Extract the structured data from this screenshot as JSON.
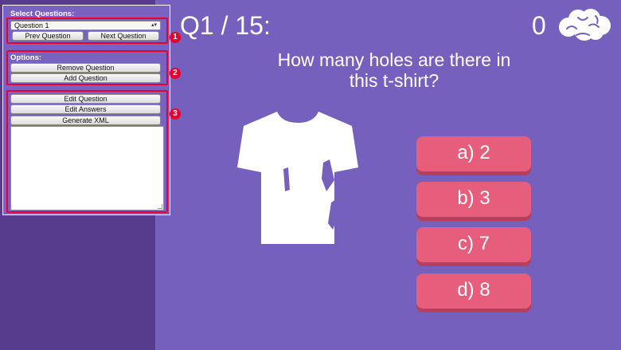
{
  "editor": {
    "select_questions_label": "Select Questions:",
    "selected_question": "Question 1",
    "prev_button": "Prev Question",
    "next_button": "Next Question",
    "options_label": "Options:",
    "remove_button": "Remove Question",
    "add_button": "Add Question",
    "edit_question_button": "Edit Question",
    "edit_answers_button": "Edit Answers",
    "generate_xml_button": "Generate XML",
    "badges": [
      "1",
      "2",
      "3"
    ]
  },
  "quiz": {
    "counter": "Q1 / 15:",
    "score": "0",
    "question": "How many holes are there in this t-shirt?",
    "answers": [
      "a) 2",
      "b) 3",
      "c) 7",
      "d) 8"
    ]
  },
  "colors": {
    "background": "#7660bd",
    "sidebar": "#573b8c",
    "answer_button": "#e65e7c",
    "highlight": "#e8002b"
  },
  "icons": [
    "brain-icon",
    "tshirt-icon",
    "select-arrows-icon",
    "resize-grip-icon"
  ]
}
